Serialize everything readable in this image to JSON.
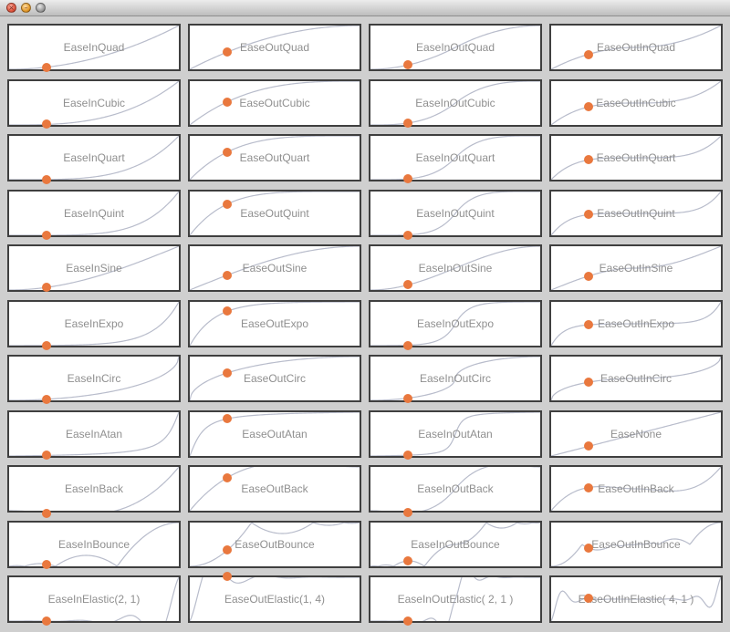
{
  "window": {
    "buttons": [
      {
        "name": "close-button",
        "glyph": "×"
      },
      {
        "name": "minimize-button",
        "glyph": "–"
      },
      {
        "name": "zoom-button",
        "glyph": ""
      }
    ]
  },
  "colors": {
    "curve": "#b8bccb",
    "dot": "#e9783e",
    "label": "#8f8f8f",
    "frame": "#3f3f3f"
  },
  "progress_t": 0.22,
  "easings": [
    {
      "label": "EaseInQuad",
      "fn": "InQuad"
    },
    {
      "label": "EaseOutQuad",
      "fn": "OutQuad"
    },
    {
      "label": "EaseInOutQuad",
      "fn": "InOutQuad"
    },
    {
      "label": "EaseOutInQuad",
      "fn": "OutInQuad"
    },
    {
      "label": "EaseInCubic",
      "fn": "InCubic"
    },
    {
      "label": "EaseOutCubic",
      "fn": "OutCubic"
    },
    {
      "label": "EaseInOutCubic",
      "fn": "InOutCubic"
    },
    {
      "label": "EaseOutInCubic",
      "fn": "OutInCubic"
    },
    {
      "label": "EaseInQuart",
      "fn": "InQuart"
    },
    {
      "label": "EaseOutQuart",
      "fn": "OutQuart"
    },
    {
      "label": "EaseInOutQuart",
      "fn": "InOutQuart"
    },
    {
      "label": "EaseOutInQuart",
      "fn": "OutInQuart"
    },
    {
      "label": "EaseInQuint",
      "fn": "InQuint"
    },
    {
      "label": "EaseOutQuint",
      "fn": "OutQuint"
    },
    {
      "label": "EaseInOutQuint",
      "fn": "InOutQuint"
    },
    {
      "label": "EaseOutInQuint",
      "fn": "OutInQuint"
    },
    {
      "label": "EaseInSine",
      "fn": "InSine"
    },
    {
      "label": "EaseOutSine",
      "fn": "OutSine"
    },
    {
      "label": "EaseInOutSine",
      "fn": "InOutSine"
    },
    {
      "label": "EaseOutInSine",
      "fn": "OutInSine"
    },
    {
      "label": "EaseInExpo",
      "fn": "InExpo"
    },
    {
      "label": "EaseOutExpo",
      "fn": "OutExpo"
    },
    {
      "label": "EaseInOutExpo",
      "fn": "InOutExpo"
    },
    {
      "label": "EaseOutInExpo",
      "fn": "OutInExpo"
    },
    {
      "label": "EaseInCirc",
      "fn": "InCirc"
    },
    {
      "label": "EaseOutCirc",
      "fn": "OutCirc"
    },
    {
      "label": "EaseInOutCirc",
      "fn": "InOutCirc"
    },
    {
      "label": "EaseOutInCirc",
      "fn": "OutInCirc"
    },
    {
      "label": "EaseInAtan",
      "fn": "InAtan"
    },
    {
      "label": "EaseOutAtan",
      "fn": "OutAtan"
    },
    {
      "label": "EaseInOutAtan",
      "fn": "InOutAtan"
    },
    {
      "label": "EaseNone",
      "fn": "None"
    },
    {
      "label": "EaseInBack",
      "fn": "InBack"
    },
    {
      "label": "EaseOutBack",
      "fn": "OutBack"
    },
    {
      "label": "EaseInOutBack",
      "fn": "InOutBack"
    },
    {
      "label": "EaseOutInBack",
      "fn": "OutInBack"
    },
    {
      "label": "EaseInBounce",
      "fn": "InBounce"
    },
    {
      "label": "EaseOutBounce",
      "fn": "OutBounce"
    },
    {
      "label": "EaseInOutBounce",
      "fn": "InOutBounce"
    },
    {
      "label": "EaseOutInBounce",
      "fn": "OutInBounce"
    },
    {
      "label": "EaseInElastic(2, 1)",
      "fn": "InElastic"
    },
    {
      "label": "EaseOutElastic(1, 4)",
      "fn": "OutElastic"
    },
    {
      "label": "EaseInOutElastic( 2, 1 )",
      "fn": "InOutElastic"
    },
    {
      "label": "EaseOutInElastic( 4, 1 )",
      "fn": "OutInElastic"
    }
  ]
}
